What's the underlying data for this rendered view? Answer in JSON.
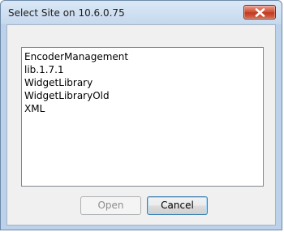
{
  "window": {
    "title": "Select Site on 10.6.0.75",
    "close_icon": "close-x-icon"
  },
  "site_list": {
    "items": [
      {
        "label": "EncoderManagement"
      },
      {
        "label": "lib.1.7.1"
      },
      {
        "label": "WidgetLibrary"
      },
      {
        "label": "WidgetLibraryOld"
      },
      {
        "label": "XML"
      }
    ]
  },
  "buttons": {
    "open_label": "Open",
    "open_enabled": false,
    "cancel_label": "Cancel"
  },
  "colors": {
    "titlebar": "#c6d9ee",
    "close_button": "#c0391f",
    "dialog_background": "#f0f0f0"
  }
}
